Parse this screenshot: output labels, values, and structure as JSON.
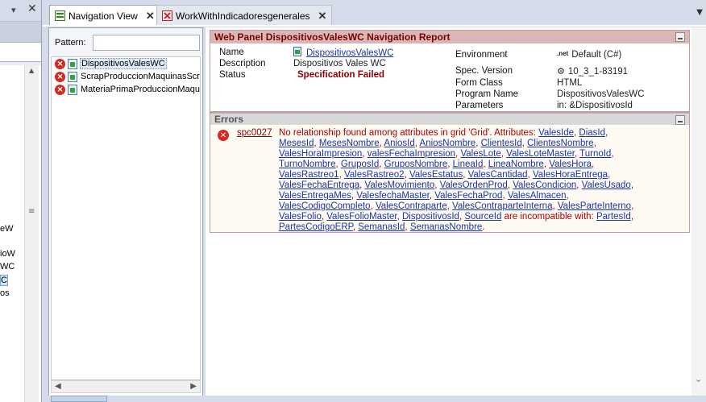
{
  "tabs": [
    {
      "label": "Navigation View",
      "active": true
    },
    {
      "label": "WorkWithIndicadoresgenerales",
      "active": false
    }
  ],
  "left_pane": {
    "lines": [
      "eW",
      "ioW",
      "WC",
      "C",
      "os"
    ]
  },
  "navigation": {
    "pattern_label": "Pattern:",
    "pattern_value": "",
    "items": [
      {
        "label": "DispositivosValesWC",
        "selected": true
      },
      {
        "label": "ScrapProduccionMaquinasScr",
        "selected": false
      },
      {
        "label": "MateriaPrimaProduccionMaqui",
        "selected": false
      }
    ]
  },
  "report": {
    "title": "Web Panel DispositivosValesWC Navigation Report",
    "name_label": "Name",
    "name_value": "DispositivosValesWC",
    "description_label": "Description",
    "description_value": "Dispositivos Vales WC",
    "status_label": "Status",
    "status_value": "Specification Failed",
    "environment_label": "Environment",
    "environment_logo": ".net",
    "environment_value": "Default (C#)",
    "spec_version_label": "Spec. Version",
    "spec_version_value": "10_3_1-83191",
    "form_class_label": "Form Class",
    "form_class_value": "HTML",
    "program_name_label": "Program Name",
    "program_name_value": "DispositivosValesWC",
    "parameters_label": "Parameters",
    "parameters_value": "in: &DispositivosId"
  },
  "errors": {
    "header": "Errors",
    "code": "spc0027",
    "message_prefix": "No relationship found among attributes in grid 'Grid'. Attributes:",
    "attributes": [
      "ValesIde",
      "DiasId",
      "MesesId",
      "MesesNombre",
      "AniosId",
      "AniosNombre",
      "ClientesId",
      "ClientesNombre",
      "ValesHoraImpresion",
      "valesFechaImpresion",
      "ValesLote",
      "ValesLoteMaster",
      "TurnoId",
      "TurnoNombre",
      "GruposId",
      "GruposNombre",
      "LineaId",
      "LineaNombre",
      "ValesHora",
      "ValesRastreo1",
      "ValesRastreo2",
      "ValesEstatus",
      "ValesCantidad",
      "ValesHoraEntrega",
      "ValesFechaEntrega",
      "ValesMovimiento",
      "ValesOrdenProd",
      "ValesCondicion",
      "ValesUsado",
      "ValesEntregaMes",
      "ValesfechaMaster",
      "ValesFechaProd",
      "ValesAlmacen",
      "ValesCodigoCompleto",
      "ValesContraparte",
      "ValesContraparteInterna",
      "ValesParteInterno",
      "ValesFolio",
      "ValesFolioMaster",
      "DispositivosId",
      "SourceId"
    ],
    "incompatible_text": "are incompatible with:",
    "incompatible_attributes": [
      "PartesId",
      "PartesCodigoERP",
      "SemanasId",
      "SemanasNombre"
    ]
  }
}
